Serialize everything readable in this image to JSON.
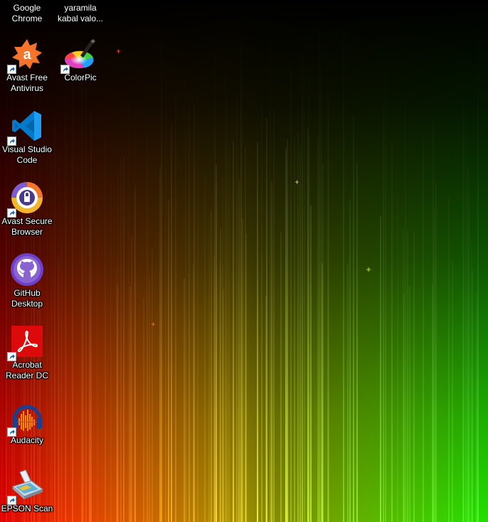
{
  "desktop": {
    "icons": [
      {
        "label": "Google Chrome",
        "icon": "google-chrome-icon"
      },
      {
        "label": "yaramila kabal valo...",
        "icon": "file-icon"
      },
      {
        "label": "Avast Free Antivirus",
        "icon": "avast-antivirus-icon"
      },
      {
        "label": "ColorPic",
        "icon": "colorpic-icon"
      },
      {
        "label": "Visual Studio Code",
        "icon": "vscode-icon"
      },
      {
        "label": "Avast Secure Browser",
        "icon": "avast-browser-icon"
      },
      {
        "label": "GitHub Desktop",
        "icon": "github-desktop-icon"
      },
      {
        "label": "Acrobat Reader DC",
        "icon": "acrobat-reader-icon"
      },
      {
        "label": "Audacity",
        "icon": "audacity-icon"
      },
      {
        "label": "EPSON Scan",
        "icon": "epson-scan-icon"
      }
    ]
  },
  "colors": {
    "wallpaper_red": "#e00000",
    "wallpaper_yellow": "#e8d000",
    "wallpaper_green": "#20e000",
    "avast_orange": "#f5742b",
    "vscode_blue": "#007acc",
    "github_purple": "#6e40c9",
    "acrobat_red": "#dc0a0a",
    "audacity_orange": "#ff8f00"
  }
}
